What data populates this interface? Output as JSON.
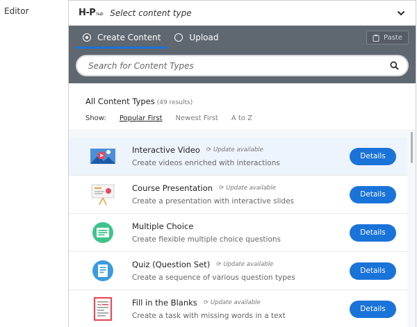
{
  "page": {
    "label": "Editor"
  },
  "hub": {
    "logo_main": "H-P",
    "logo_sub": "hub",
    "header_title": "Select content type"
  },
  "tabs": [
    {
      "label": "Create Content",
      "active": true
    },
    {
      "label": "Upload",
      "active": false
    }
  ],
  "paste_label": "Paste",
  "search": {
    "placeholder": "Search for Content Types",
    "value": ""
  },
  "results": {
    "title": "All Content Types",
    "count": "(49 results)",
    "show_label": "Show:",
    "sort_options": [
      "Popular First",
      "Newest First",
      "A to Z"
    ],
    "active_sort": "Popular First"
  },
  "items": [
    {
      "title": "Interactive Video",
      "update": "Update available",
      "desc": "Create videos enriched with interactions",
      "button": "Details",
      "icon": "interactive-video-icon"
    },
    {
      "title": "Course Presentation",
      "update": "Update available",
      "desc": "Create a presentation with interactive slides",
      "button": "Details",
      "icon": "course-presentation-icon"
    },
    {
      "title": "Multiple Choice",
      "update": "",
      "desc": "Create flexible multiple choice questions",
      "button": "Details",
      "icon": "multiple-choice-icon"
    },
    {
      "title": "Quiz (Question Set)",
      "update": "Update available",
      "desc": "Create a sequence of various question types",
      "button": "Details",
      "icon": "quiz-icon"
    },
    {
      "title": "Fill in the Blanks",
      "update": "Update available",
      "desc": "Create a task with missing words in a text",
      "button": "Details",
      "icon": "fill-in-blanks-icon"
    }
  ],
  "colors": {
    "accent": "#1a73d9",
    "bar": "#5f6771",
    "highlight_row": "#eef4fb"
  }
}
